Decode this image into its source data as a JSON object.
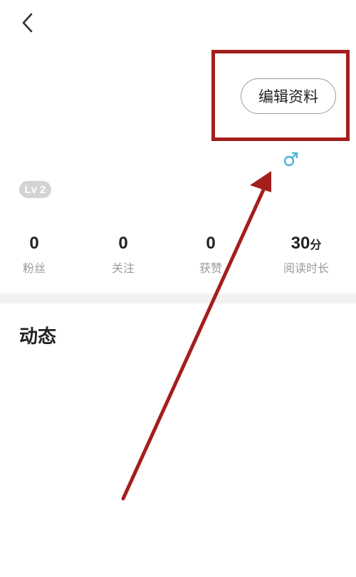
{
  "header": {
    "back_icon": "chevron-left-icon"
  },
  "profile": {
    "edit_button_label": "编辑资料",
    "gender_symbol": "♂",
    "gender_color": "#4fb3d9",
    "level_badge": "Lv 2"
  },
  "stats": [
    {
      "value": "0",
      "unit": "",
      "label": "粉丝"
    },
    {
      "value": "0",
      "unit": "",
      "label": "关注"
    },
    {
      "value": "0",
      "unit": "",
      "label": "获赞"
    },
    {
      "value": "30",
      "unit": "分",
      "label": "阅读时长"
    }
  ],
  "feed": {
    "section_title": "动态"
  },
  "annotation": {
    "color": "#a41e1e"
  }
}
